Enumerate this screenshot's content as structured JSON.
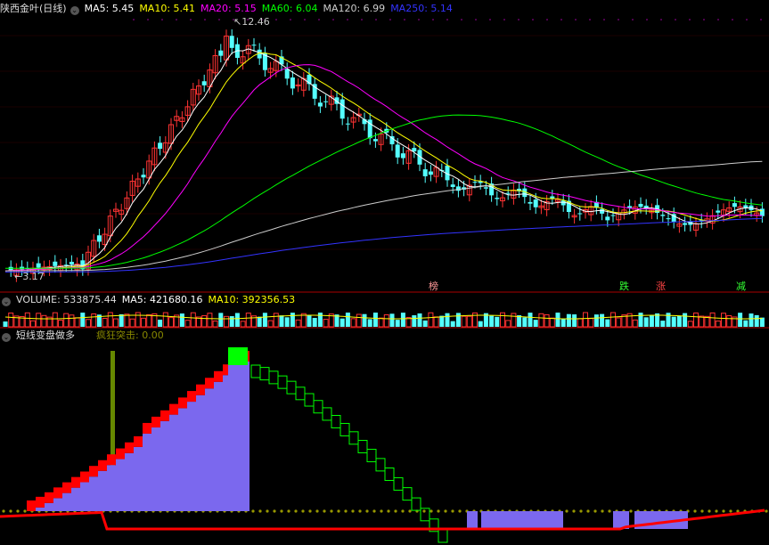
{
  "main": {
    "title": "陕西金叶(日线)",
    "ma": [
      {
        "label": "MA5: 5.45",
        "color": "#ffffff"
      },
      {
        "label": "MA10: 5.41",
        "color": "#ffff00"
      },
      {
        "label": "MA20: 5.15",
        "color": "#ff00ff"
      },
      {
        "label": "MA60: 6.04",
        "color": "#00ff00"
      },
      {
        "label": "MA120: 6.99",
        "color": "#cccccc"
      },
      {
        "label": "MA250: 5.14",
        "color": "#3333ff"
      }
    ],
    "high_label": "12.46",
    "low_label": "3.17",
    "tags": [
      {
        "text": "榜",
        "color": "#ff9999"
      },
      {
        "text": "跌",
        "color": "#33ff33"
      },
      {
        "text": "涨",
        "color": "#ff4444"
      },
      {
        "text": "减",
        "color": "#33ff33"
      }
    ]
  },
  "volume": {
    "label": "VOLUME: 533875.44",
    "ma5": "MA5: 421680.16",
    "ma10": "MA10: 392356.53"
  },
  "indicator": {
    "title": "短线变盘做多",
    "signal": "疯狂突击: 0.00"
  },
  "chart_data": {
    "type": "candlestick",
    "series": [
      {
        "name": "MA5",
        "color": "#ffffff"
      },
      {
        "name": "MA10",
        "color": "#ffff00"
      },
      {
        "name": "MA20",
        "color": "#ff00ff"
      },
      {
        "name": "MA60",
        "color": "#00ff00"
      },
      {
        "name": "MA120",
        "color": "#cccccc"
      },
      {
        "name": "MA250",
        "color": "#3333ff"
      }
    ],
    "price_range": [
      3.17,
      12.46
    ],
    "colors": {
      "up": "#ff3333",
      "down": "#54ffff",
      "ind_fill": "#7b68ee",
      "ind_red": "#ff0000",
      "ind_green": "#00ff00",
      "dots": "#999900"
    }
  }
}
